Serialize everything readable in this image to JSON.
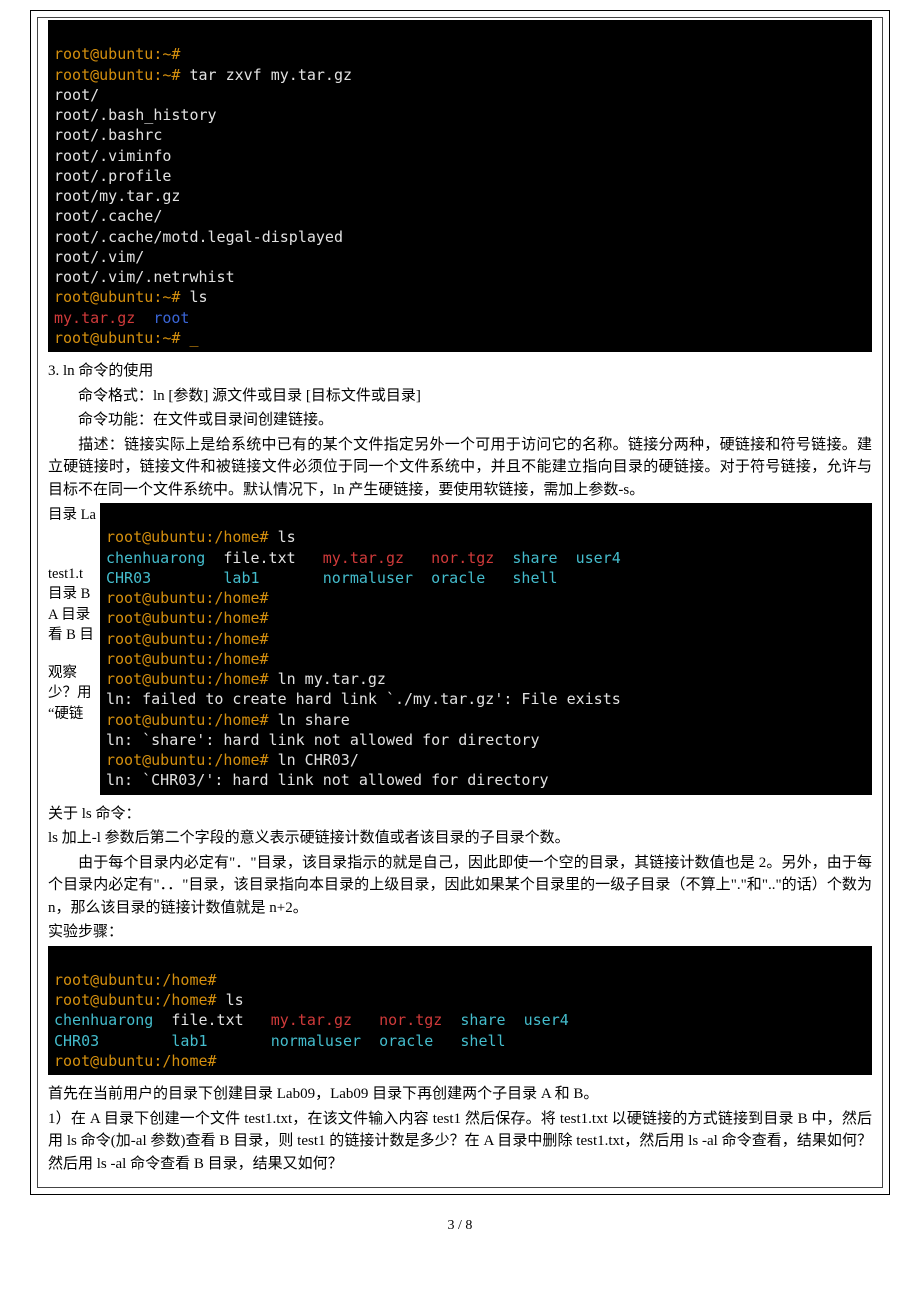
{
  "term1": {
    "l01": "root@ubuntu:~#",
    "l02a": "root@ubuntu:~# ",
    "l02b": "tar zxvf my.tar.gz",
    "l03": "root/",
    "l04": "root/.bash_history",
    "l05": "root/.bashrc",
    "l06": "root/.viminfo",
    "l07": "root/.profile",
    "l08": "root/my.tar.gz",
    "l09": "root/.cache/",
    "l10": "root/.cache/motd.legal-displayed",
    "l11": "root/.vim/",
    "l12": "root/.vim/.netrwhist",
    "l13a": "root@ubuntu:~# ",
    "l13b": "ls",
    "l14a": "my.tar.gz  ",
    "l14b": "root",
    "l15": "root@ubuntu:~# _"
  },
  "section3": {
    "title": "3. ln 命令的使用",
    "p1": "命令格式：ln [参数] 源文件或目录 [目标文件或目录]",
    "p2": "命令功能：在文件或目录间创建链接。",
    "p3": "描述：链接实际上是给系统中已有的某个文件指定另外一个可用于访问它的名称。链接分两种，硬链接和符号链接。建立硬链接时，链接文件和被链接文件必须位于同一个文件系统中，并且不能建立指向目录的硬链接。对于符号链接，允许与目标不在同一个文件系统中。默认情况下，ln 产生硬链接，要使用软链接，需加上参数-s。"
  },
  "side": {
    "s1": "目录 La",
    "s2": "test1.t",
    "s3": "目录 B",
    "s4": "A 目录",
    "s5": "看 B 目",
    "s6": " 观察",
    "s7": "少？用",
    "s8": "“硬链"
  },
  "term2": {
    "l01a": "root@ubuntu:/home# ",
    "l01b": "ls",
    "l02a": "chenhuarong  ",
    "l02b": "file.txt   ",
    "l02c": "my.tar.gz   ",
    "l02d": "nor.tgz  ",
    "l02e": "share  ",
    "l02f": "user4",
    "l03a": "CHR03        ",
    "l03b": "lab1       ",
    "l03c": "normaluser  ",
    "l03d": "oracle   ",
    "l03e": "shell",
    "l04": "root@ubuntu:/home#",
    "l05": "root@ubuntu:/home#",
    "l06": "root@ubuntu:/home#",
    "l07": "root@ubuntu:/home#",
    "l08a": "root@ubuntu:/home# ",
    "l08b": "ln my.tar.gz",
    "l09": "ln: failed to create hard link `./my.tar.gz': File exists",
    "l10a": "root@ubuntu:/home# ",
    "l10b": "ln share",
    "l11": "ln: `share': hard link not allowed for directory",
    "l12a": "root@ubuntu:/home# ",
    "l12b": "ln CHR03/",
    "l13": "ln: `CHR03/': hard link not allowed for directory"
  },
  "about_ls": {
    "title": "关于 ls 命令：",
    "p1": "ls 加上-l 参数后第二个字段的意义表示硬链接计数值或者该目录的子目录个数。",
    "p2": "由于每个目录内必定有\"．\"目录，该目录指示的就是自己，因此即使一个空的目录，其链接计数值也是 2。另外，由于每个目录内必定有\"．．\"目录，该目录指向本目录的上级目录，因此如果某个目录里的一级子目录（不算上\".\"和\"..\"的话）个数为 n，那么该目录的链接计数值就是 n+2。",
    "p3": "实验步骤："
  },
  "term3": {
    "l01": "root@ubuntu:/home#",
    "l02a": "root@ubuntu:/home# ",
    "l02b": "ls",
    "l03a": "chenhuarong  ",
    "l03b": "file.txt   ",
    "l03c": "my.tar.gz   ",
    "l03d": "nor.tgz  ",
    "l03e": "share  ",
    "l03f": "user4",
    "l04a": "CHR03        ",
    "l04b": "lab1       ",
    "l04c": "normaluser  ",
    "l04d": "oracle   ",
    "l04e": "shell",
    "l05": "root@ubuntu:/home#"
  },
  "steps": {
    "p1": "首先在当前用户的目录下创建目录 Lab09，Lab09 目录下再创建两个子目录 A 和 B。",
    "p2": "1）在 A 目录下创建一个文件 test1.txt，在该文件输入内容 test1 然后保存。将 test1.txt 以硬链接的方式链接到目录 B 中，然后用 ls 命令(加-al 参数)查看 B 目录，则 test1 的链接计数是多少？在 A 目录中删除 test1.txt，然后用 ls -al 命令查看，结果如何？然后用 ls -al 命令查看 B 目录，结果又如何？"
  },
  "pagenum": "3 / 8"
}
